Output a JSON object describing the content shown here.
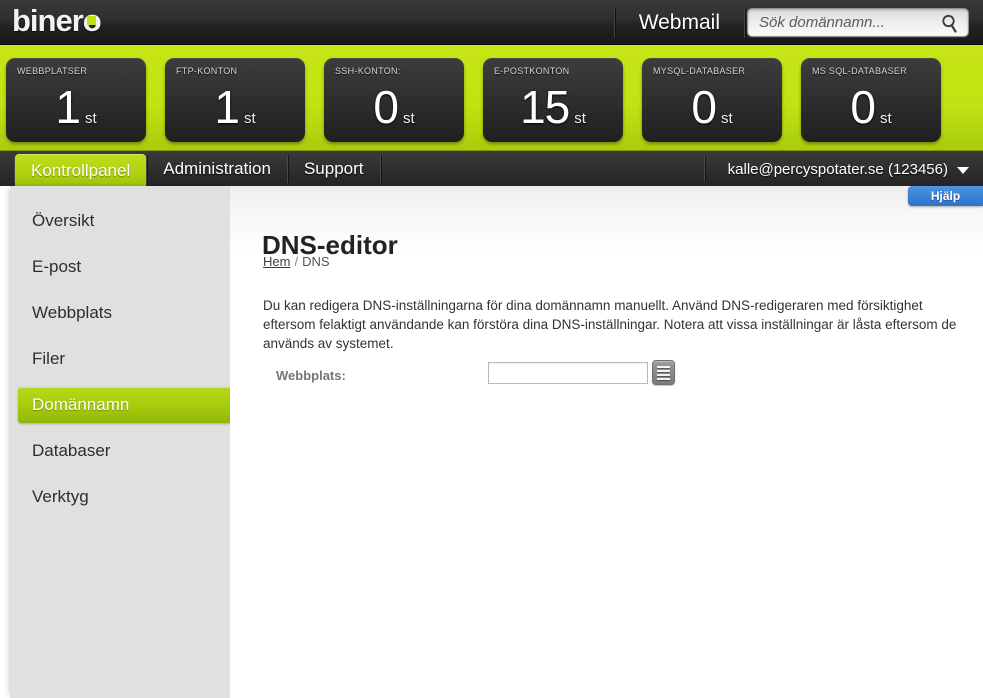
{
  "header": {
    "logo_text": "binero",
    "webmail_label": "Webmail",
    "search_placeholder": "Sök domännamn...",
    "search_value": "",
    "search_icon": "search-icon"
  },
  "stats": [
    {
      "label": "WEBBPLATSER",
      "value": "1",
      "unit": "st"
    },
    {
      "label": "FTP-KONTON",
      "value": "1",
      "unit": "st"
    },
    {
      "label": "SSH-KONTON:",
      "value": "0",
      "unit": "st"
    },
    {
      "label": "E-POSTKONTON",
      "value": "15",
      "unit": "st"
    },
    {
      "label": "MYSQL-DATABASER",
      "value": "0",
      "unit": "st"
    },
    {
      "label": "MS SQL-DATABASER",
      "value": "0",
      "unit": "st"
    }
  ],
  "tabs": [
    {
      "label": "Kontrollpanel",
      "active": true
    },
    {
      "label": "Administration",
      "active": false
    },
    {
      "label": "Support",
      "active": false
    }
  ],
  "account": {
    "name": "kalle@percyspotater.se (123456)",
    "chevron_icon": "chevron-down-icon"
  },
  "sidebar": {
    "items": [
      {
        "label": "Översikt",
        "active": false
      },
      {
        "label": "E-post",
        "active": false
      },
      {
        "label": "Webbplats",
        "active": false
      },
      {
        "label": "Filer",
        "active": false
      },
      {
        "label": "Domännamn",
        "active": true
      },
      {
        "label": "Databaser",
        "active": false
      },
      {
        "label": "Verktyg",
        "active": false
      }
    ]
  },
  "content": {
    "help_label": "Hjälp",
    "title": "DNS-editor",
    "breadcrumb": {
      "home": "Hem",
      "separator": "/",
      "current": "DNS"
    },
    "description": "Du kan redigera DNS-inställningarna för dina domännamn manuellt. Använd DNS-redigeraren med försiktighet eftersom felaktigt användande kan förstöra dina DNS-inställningar. Notera att vissa inställningar är låsta eftersom de används av systemet.",
    "form": {
      "website_label": "Webbplats:",
      "website_value": "",
      "website_placeholder": "",
      "picker_icon": "list-picker-icon"
    }
  },
  "colors": {
    "brand_green": "#c2e312",
    "accent_blue": "#3a81d4",
    "dark_bar": "#2e2e2e",
    "sidebar_grey": "#e0e0e0"
  }
}
